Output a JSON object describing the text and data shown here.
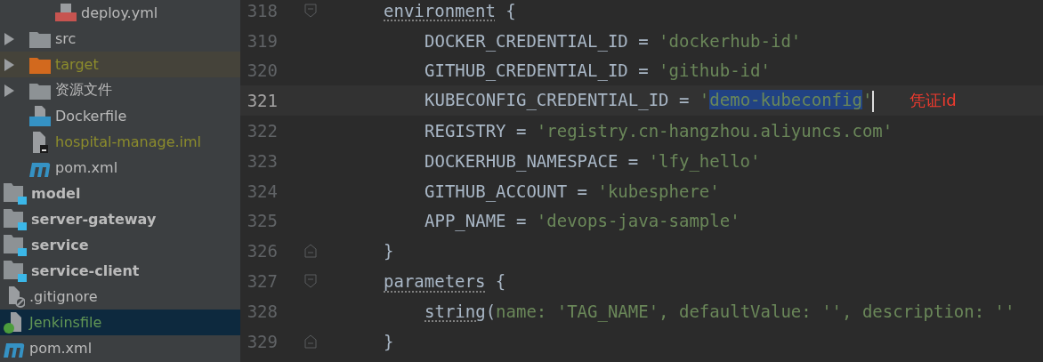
{
  "project_tree": {
    "nested_files": [
      {
        "label": "deploy.yml",
        "kind": "yml",
        "color": "#bbbbbb",
        "selected": false
      }
    ],
    "module_files": [
      {
        "label": "src",
        "kind": "folder",
        "color": "#bbbbbb",
        "expanded": false,
        "selected": false
      },
      {
        "label": "target",
        "kind": "excluded-folder",
        "color": "#8c8c2c",
        "expanded": false,
        "selected": false
      },
      {
        "label": "资源文件",
        "kind": "folder",
        "color": "#bbbbbb",
        "expanded": false,
        "selected": false
      },
      {
        "label": "Dockerfile",
        "kind": "docker",
        "color": "#bbbbbb",
        "selected": false
      },
      {
        "label": "hospital-manage.iml",
        "kind": "iml",
        "color": "#8c8c2c",
        "selected": false
      },
      {
        "label": "pom.xml",
        "kind": "maven",
        "color": "#bbbbbb",
        "selected": false
      }
    ],
    "project_items": [
      {
        "label": "model",
        "kind": "module",
        "color": "#bbbbbb",
        "selected": false
      },
      {
        "label": "server-gateway",
        "kind": "module",
        "color": "#bbbbbb",
        "selected": false
      },
      {
        "label": "service",
        "kind": "module",
        "color": "#bbbbbb",
        "selected": false
      },
      {
        "label": "service-client",
        "kind": "module",
        "color": "#bbbbbb",
        "selected": false
      },
      {
        "label": ".gitignore",
        "kind": "gitignore",
        "color": "#bbbbbb",
        "selected": false
      },
      {
        "label": "Jenkinsfile",
        "kind": "jenkins",
        "color": "#629755",
        "selected": true
      },
      {
        "label": "pom.xml",
        "kind": "maven",
        "color": "#bbbbbb",
        "selected": false
      }
    ]
  },
  "editor": {
    "lines": [
      {
        "number": "318",
        "current": false,
        "expanded": true,
        "kind": "block-start",
        "segments": [
          {
            "kind": "call",
            "text": "environment"
          },
          {
            "kind": "plain",
            "text": " {"
          }
        ]
      },
      {
        "number": "319",
        "current": false,
        "kind": "inner",
        "segments": [
          {
            "kind": "plain",
            "text": "DOCKER_CREDENTIAL_ID = "
          },
          {
            "kind": "string",
            "text": "'dockerhub-id'"
          }
        ]
      },
      {
        "number": "320",
        "current": false,
        "kind": "inner",
        "segments": [
          {
            "kind": "plain",
            "text": "GITHUB_CREDENTIAL_ID = "
          },
          {
            "kind": "string",
            "text": "'github-id'"
          }
        ]
      },
      {
        "number": "321",
        "current": true,
        "kind": "inner",
        "segments": [
          {
            "kind": "plain",
            "text": "KUBECONFIG_CREDENTIAL_ID = "
          },
          {
            "kind": "string",
            "text": "'"
          },
          {
            "kind": "selection",
            "text": "demo-kubeconfig"
          },
          {
            "kind": "string",
            "text": "'"
          }
        ],
        "note": "凭证id"
      },
      {
        "number": "322",
        "current": false,
        "kind": "inner",
        "segments": [
          {
            "kind": "plain",
            "text": "REGISTRY = "
          },
          {
            "kind": "string",
            "text": "'registry.cn-hangzhou.aliyuncs.com'"
          }
        ]
      },
      {
        "number": "323",
        "current": false,
        "kind": "inner",
        "segments": [
          {
            "kind": "plain",
            "text": "DOCKERHUB_NAMESPACE = "
          },
          {
            "kind": "string",
            "text": "'lfy_hello'"
          }
        ]
      },
      {
        "number": "324",
        "current": false,
        "kind": "inner",
        "segments": [
          {
            "kind": "plain",
            "text": "GITHUB_ACCOUNT = "
          },
          {
            "kind": "string",
            "text": "'kubesphere'"
          }
        ]
      },
      {
        "number": "325",
        "current": false,
        "kind": "inner",
        "segments": [
          {
            "kind": "plain",
            "text": "APP_NAME = "
          },
          {
            "kind": "string",
            "text": "'devops-java-sample'"
          }
        ]
      },
      {
        "number": "326",
        "current": false,
        "expanded": true,
        "kind": "block-end",
        "segments": [
          {
            "kind": "plain",
            "text": "}"
          }
        ]
      },
      {
        "number": "327",
        "current": false,
        "expanded": true,
        "kind": "block-start",
        "segments": [
          {
            "kind": "call",
            "text": "parameters"
          },
          {
            "kind": "plain",
            "text": " {"
          }
        ]
      },
      {
        "number": "328",
        "current": false,
        "kind": "inner",
        "segments": [
          {
            "kind": "call",
            "text": "string"
          },
          {
            "kind": "plain",
            "text": "("
          },
          {
            "kind": "string",
            "text": "name: 'TAG_NAME', defaultValue: '', description: ''"
          }
        ]
      },
      {
        "number": "329",
        "current": false,
        "expanded": true,
        "kind": "block-end",
        "segments": [
          {
            "kind": "plain",
            "text": "}"
          }
        ]
      }
    ]
  }
}
